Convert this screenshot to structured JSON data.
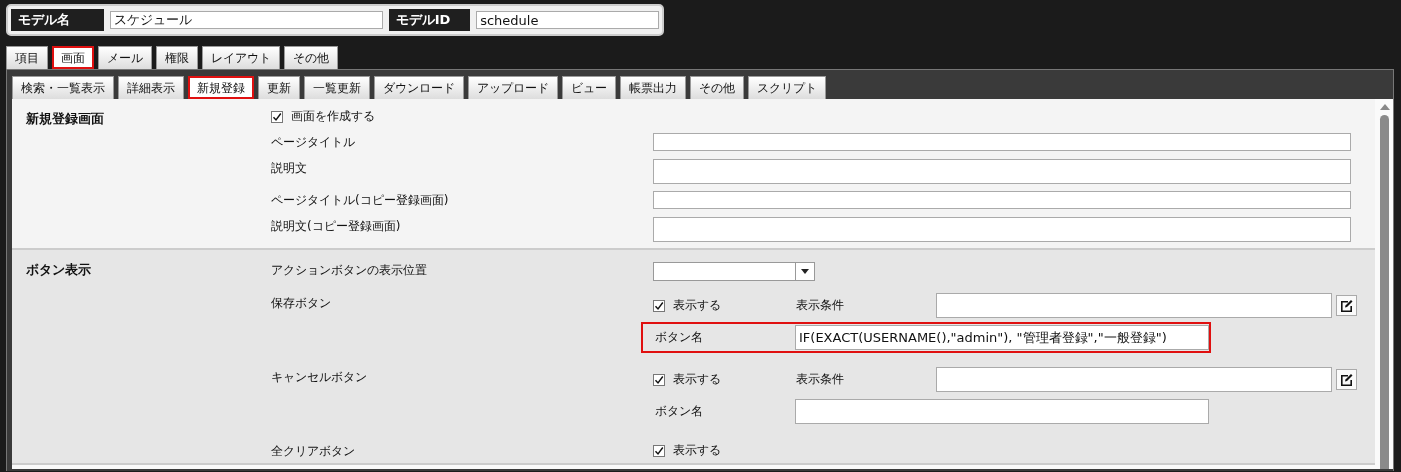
{
  "model_bar": {
    "name_label": "モデル名",
    "name_value": "スケジュール",
    "id_label": "モデルID",
    "id_value": "schedule"
  },
  "tabs": [
    {
      "label": "項目",
      "selected": false
    },
    {
      "label": "画面",
      "selected": true
    },
    {
      "label": "メール",
      "selected": false
    },
    {
      "label": "権限",
      "selected": false
    },
    {
      "label": "レイアウト",
      "selected": false
    },
    {
      "label": "その他",
      "selected": false
    }
  ],
  "sub_tabs": [
    {
      "label": "検索・一覧表示",
      "selected": false
    },
    {
      "label": "詳細表示",
      "selected": false
    },
    {
      "label": "新規登録",
      "selected": true
    },
    {
      "label": "更新",
      "selected": false
    },
    {
      "label": "一覧更新",
      "selected": false
    },
    {
      "label": "ダウンロード",
      "selected": false
    },
    {
      "label": "アップロード",
      "selected": false
    },
    {
      "label": "ビュー",
      "selected": false
    },
    {
      "label": "帳票出力",
      "selected": false
    },
    {
      "label": "その他",
      "selected": false
    },
    {
      "label": "スクリプト",
      "selected": false
    }
  ],
  "screen_section": {
    "title": "新規登録画面",
    "create": {
      "label": "画面を作成する",
      "checked": true
    },
    "fields": [
      {
        "label": "ページタイトル",
        "kind": "line"
      },
      {
        "label": "説明文",
        "kind": "area"
      },
      {
        "label": "ページタイトル(コピー登録画面)",
        "kind": "line"
      },
      {
        "label": "説明文(コピー登録画面)",
        "kind": "area"
      }
    ]
  },
  "button_section": {
    "title": "ボタン表示",
    "position_label": "アクションボタンの表示位置",
    "buttons": [
      {
        "label": "保存ボタン",
        "show": {
          "label": "表示する",
          "checked": true
        },
        "condition_label": "表示条件",
        "name_label": "ボタン名",
        "name_value": "IF(EXACT(USERNAME(),\"admin\"), \"管理者登録\",\"一般登録\")",
        "highlighted": true
      },
      {
        "label": "キャンセルボタン",
        "show": {
          "label": "表示する",
          "checked": true
        },
        "condition_label": "表示条件",
        "name_label": "ボタン名",
        "highlighted": false
      },
      {
        "label": "全クリアボタン",
        "show": {
          "label": "表示する",
          "checked": true
        }
      }
    ]
  }
}
